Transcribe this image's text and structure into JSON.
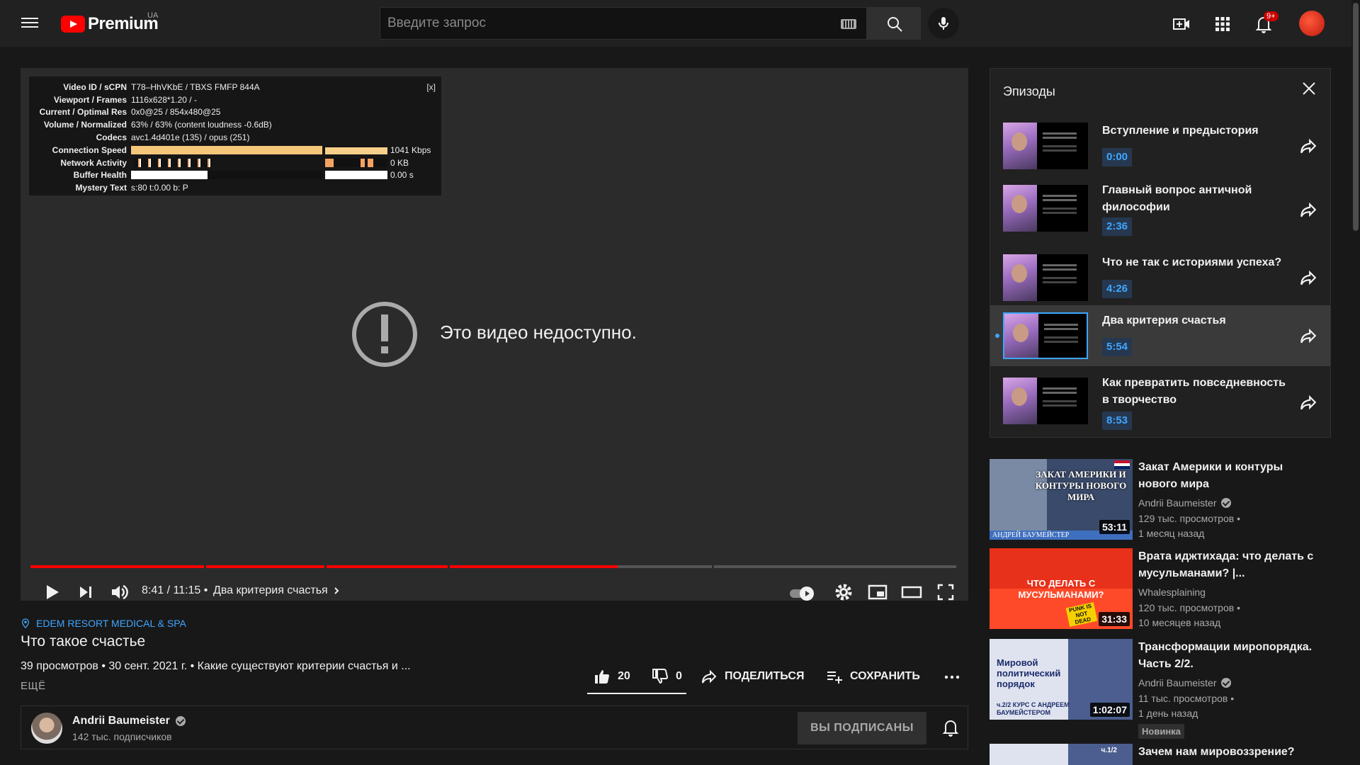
{
  "header": {
    "logo_text": "Premium",
    "country": "UA",
    "search_placeholder": "Введите запрос",
    "notif_count": "9+"
  },
  "player": {
    "stats": {
      "close": "[x]",
      "rows": [
        {
          "label": "Video ID / sCPN",
          "value": "T78–HhVKbE / TBXS FMFP 844A"
        },
        {
          "label": "Viewport / Frames",
          "value": "1116x628*1.20 / -"
        },
        {
          "label": "Current / Optimal Res",
          "value": "0x0@25 / 854x480@25"
        },
        {
          "label": "Volume / Normalized",
          "value": "63% / 63% (content loudness -0.6dB)"
        },
        {
          "label": "Codecs",
          "value": "avc1.4d401e (135) / opus (251)"
        },
        {
          "label": "Connection Speed",
          "value": "1041 Kbps"
        },
        {
          "label": "Network Activity",
          "value": "0 KB"
        },
        {
          "label": "Buffer Health",
          "value": "0.00 s"
        },
        {
          "label": "Mystery Text",
          "value": "s:80 t:0.00 b: P"
        }
      ]
    },
    "unavailable": "Это видео недоступно.",
    "progress": {
      "played_fraction": 0.633,
      "chapter_starts": [
        0,
        0.0,
        0.189,
        0.319,
        0.452,
        0.737,
        1.0
      ]
    },
    "time": "8:41 / 11:15",
    "separator": "•",
    "chapter": "Два критерия счастья"
  },
  "video": {
    "location": "EDEM RESORT MEDICAL & SPA",
    "title": "Что такое счастье",
    "meta": "39 просмотров • 30 сент. 2021 г. • Какие существуют критерии счастья и ...",
    "more": "ЕЩЁ",
    "likes": "20",
    "dislikes": "0",
    "share": "ПОДЕЛИТЬСЯ",
    "save": "СОХРАНИТЬ"
  },
  "channel": {
    "name": "Andrii Baumeister",
    "subs": "142 тыс. подписчиков",
    "subscribed": "ВЫ ПОДПИСАНЫ"
  },
  "episodes": {
    "title": "Эпизоды",
    "items": [
      {
        "title": "Вступление и предыстория",
        "time": "0:00"
      },
      {
        "title": "Главный вопрос античной философии",
        "time": "2:36"
      },
      {
        "title": "Что не так с историями успеха?",
        "time": "4:26"
      },
      {
        "title": "Два критерия счастья",
        "time": "5:54"
      },
      {
        "title": "Как превратить повседневность в творчество",
        "time": "8:53"
      }
    ]
  },
  "recommendations": [
    {
      "title": "Закат Америки и контуры нового мира",
      "channel": "Andrii Baumeister",
      "views": "129 тыс. просмотров •",
      "ago": "1 месяц назад",
      "duration": "53:11",
      "thumb_text": "ЗАКАТ АМЕРИКИ И КОНТУРЫ НОВОГО МИРА",
      "thumb_caption": "АНДРЕЙ БАУМЕЙСТЕР"
    },
    {
      "title": "Врата иджтихада: что делать с мусульманами? |...",
      "channel": "Whalesplaining",
      "views": "120 тыс. просмотров •",
      "ago": "10 месяцев назад",
      "duration": "31:33",
      "thumb_text": "ЧТО ДЕЛАТЬ С МУСУЛЬМАНАМИ?",
      "thumb_caption": "PUNK IS NOT DEAD"
    },
    {
      "title": "Трансформации миропорядка. Часть 2/2.",
      "channel": "Andrii Baumeister",
      "views": "11 тыс. просмотров •",
      "ago": "1 день назад",
      "duration": "1:02:07",
      "thumb_text": "Мировой политический порядок",
      "thumb_caption": "ч.2/2 КУРС С АНДРЕЕМ БАУМЕЙСТЕРОМ",
      "badge": "Новинка"
    },
    {
      "title": "Зачем нам мировоззрение?",
      "thumb_caption": "ч.1/2"
    }
  ]
}
